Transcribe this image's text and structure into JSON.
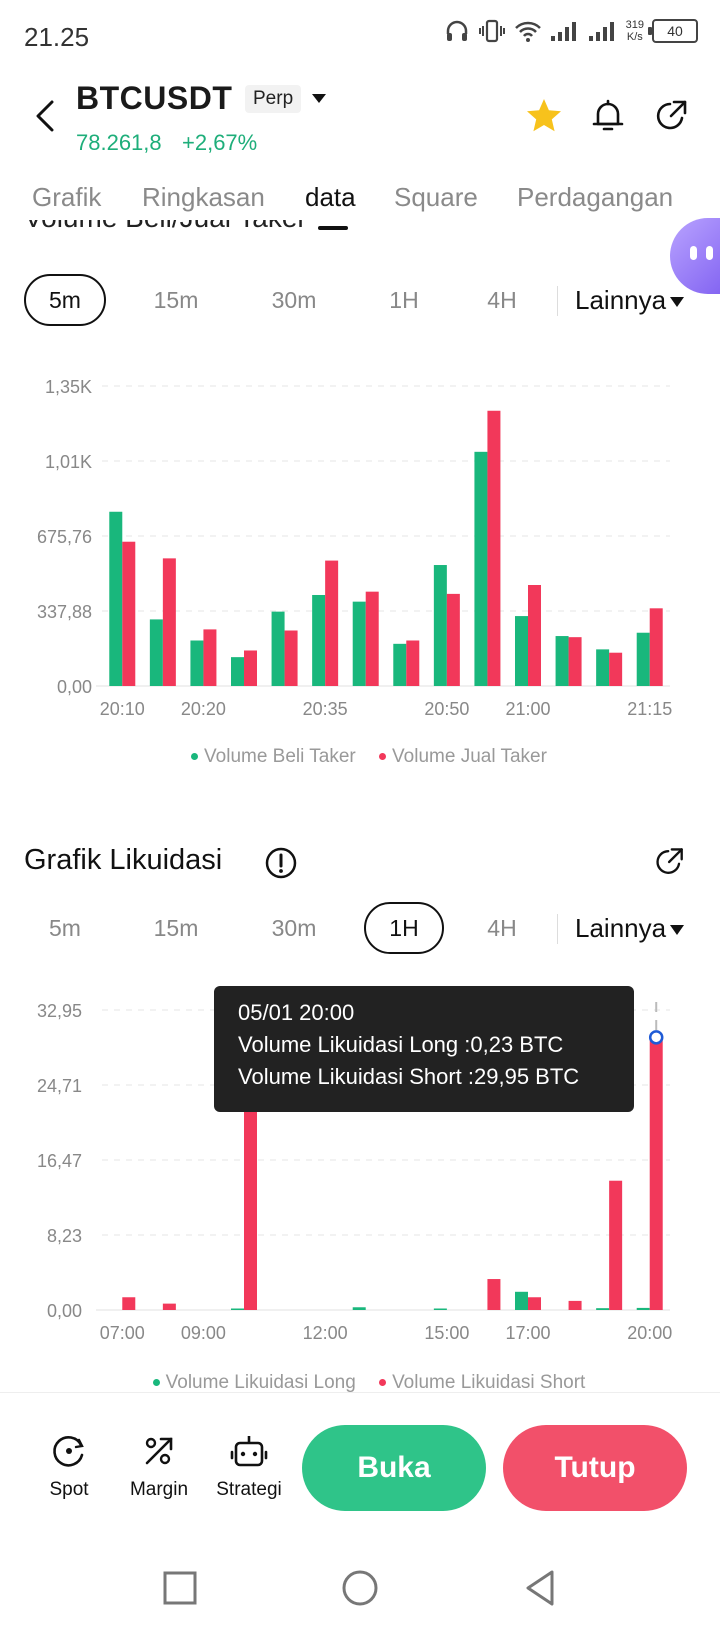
{
  "status_bar": {
    "time": "21.25",
    "net_speed_value": "319",
    "net_speed_unit": "K/s",
    "battery": "40"
  },
  "header": {
    "symbol": "BTCUSDT",
    "badge": "Perp",
    "price": "78.261,8",
    "change": "+2,67%"
  },
  "tabs": [
    {
      "label": "Grafik",
      "active": false
    },
    {
      "label": "Ringkasan",
      "active": false
    },
    {
      "label": "data",
      "active": true
    },
    {
      "label": "Square",
      "active": false
    },
    {
      "label": "Perdagangan",
      "active": false
    }
  ],
  "taker_section": {
    "partial_title": "Volume Beli/Jual Taker",
    "intervals": [
      "5m",
      "15m",
      "30m",
      "1H",
      "4H"
    ],
    "active_interval": "5m",
    "more_label": "Lainnya"
  },
  "liquidation_section": {
    "title": "Grafik Likuidasi",
    "intervals": [
      "5m",
      "15m",
      "30m",
      "1H",
      "4H"
    ],
    "active_interval": "1H",
    "more_label": "Lainnya",
    "tooltip": {
      "time": "05/01 20:00",
      "long_line": "Volume Likuidasi Long :0,23 BTC",
      "short_line": "Volume Likuidasi Short :29,95 BTC"
    }
  },
  "colors": {
    "buy": "#19b77c",
    "sell": "#f2385a",
    "accent_green": "#2fc489",
    "accent_red": "#f2506a"
  },
  "chart_data": [
    {
      "type": "bar",
      "title": "Volume Beli/Jual Taker",
      "yticks": [
        "0,00",
        "337,88",
        "675,76",
        "1,01K",
        "1,35K"
      ],
      "ylim": [
        0,
        1351.52
      ],
      "xticks": [
        "20:10",
        "20:20",
        "20:35",
        "20:50",
        "21:00",
        "21:15"
      ],
      "categories": [
        "20:10",
        "20:15",
        "20:20",
        "20:25",
        "20:30",
        "20:35",
        "20:40",
        "20:45",
        "20:50",
        "20:55",
        "21:00",
        "21:05",
        "21:10",
        "21:15"
      ],
      "series": [
        {
          "name": "Volume Beli Taker",
          "values": [
            785,
            300,
            205,
            130,
            335,
            410,
            380,
            190,
            545,
            1055,
            315,
            225,
            165,
            240
          ]
        },
        {
          "name": "Volume Jual Taker",
          "values": [
            650,
            575,
            255,
            160,
            250,
            565,
            425,
            205,
            415,
            1240,
            455,
            220,
            150,
            350
          ]
        }
      ],
      "legend": "bottom",
      "grid": true
    },
    {
      "type": "bar",
      "title": "Grafik Likuidasi",
      "yticks": [
        "0,00",
        "8,23",
        "16,47",
        "24,71",
        "32,95"
      ],
      "ylim": [
        0,
        32.95
      ],
      "xticks": [
        "07:00",
        "09:00",
        "12:00",
        "15:00",
        "17:00",
        "20:00"
      ],
      "categories": [
        "07:00",
        "08:00",
        "09:00",
        "10:00",
        "11:00",
        "12:00",
        "13:00",
        "14:00",
        "15:00",
        "16:00",
        "17:00",
        "18:00",
        "19:00",
        "20:00"
      ],
      "series": [
        {
          "name": "Volume Likuidasi Long",
          "values": [
            0,
            0,
            0,
            0.1,
            0,
            0,
            0.3,
            0,
            0.05,
            0,
            2.0,
            0,
            0.2,
            0.23
          ]
        },
        {
          "name": "Volume Likuidasi Short",
          "values": [
            1.4,
            0.7,
            0,
            26.3,
            0,
            0,
            0,
            0,
            0,
            3.4,
            1.4,
            1.0,
            14.2,
            29.95
          ]
        }
      ],
      "highlight_category": "20:00",
      "legend": "bottom",
      "grid": true
    }
  ],
  "bottom_bar": {
    "items": [
      {
        "label": "Spot",
        "icon": "spot-icon"
      },
      {
        "label": "Margin",
        "icon": "margin-icon"
      },
      {
        "label": "Strategi",
        "icon": "robot-icon"
      }
    ],
    "open_label": "Buka",
    "close_label": "Tutup"
  }
}
